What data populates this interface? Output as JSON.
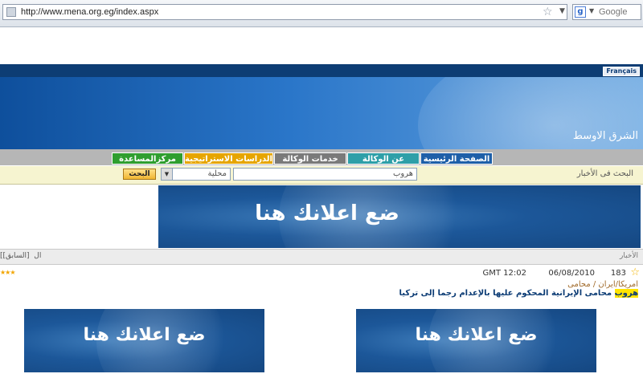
{
  "browser": {
    "url": "http://www.mena.org.eg/index.aspx",
    "search_engine": "Google",
    "icons": [
      "page-icon",
      "star-icon",
      "dropdown-icon",
      "google-icon"
    ]
  },
  "header": {
    "language_link": "Français",
    "site_title": "الشرق الاوسط"
  },
  "nav": [
    {
      "label": "الصفحة الرئيسية",
      "color": "#1e5fa8"
    },
    {
      "label": "عن الوكالة",
      "color": "#2e9fa8"
    },
    {
      "label": "خدمات الوكالة",
      "color": "#7a7a7a"
    },
    {
      "label": "الدراسات الاستراتيجية",
      "color": "#e6a500"
    },
    {
      "label": "مركزالمساعدة",
      "color": "#2f9e2f"
    }
  ],
  "search": {
    "label": "البحث فى الأخبار",
    "value": "هروب",
    "select_value": "محلية",
    "button_label": "البحث"
  },
  "ads": {
    "text": "ضع اعلانك هنا"
  },
  "news": {
    "section_title": "الأخبار",
    "prev_link": "[السابق]",
    "next_link_fragment": "[ال",
    "item": {
      "count": "183",
      "date": "06/08/2010",
      "time": "GMT 12:02",
      "category_1": "امريكا",
      "category_2": "ايران / محامى",
      "headline_highlight": "هروب",
      "headline_rest": " محامى الإيرانية المحكوم عليها بالإعدام رجما إلى تركيا",
      "rating": 3
    }
  }
}
